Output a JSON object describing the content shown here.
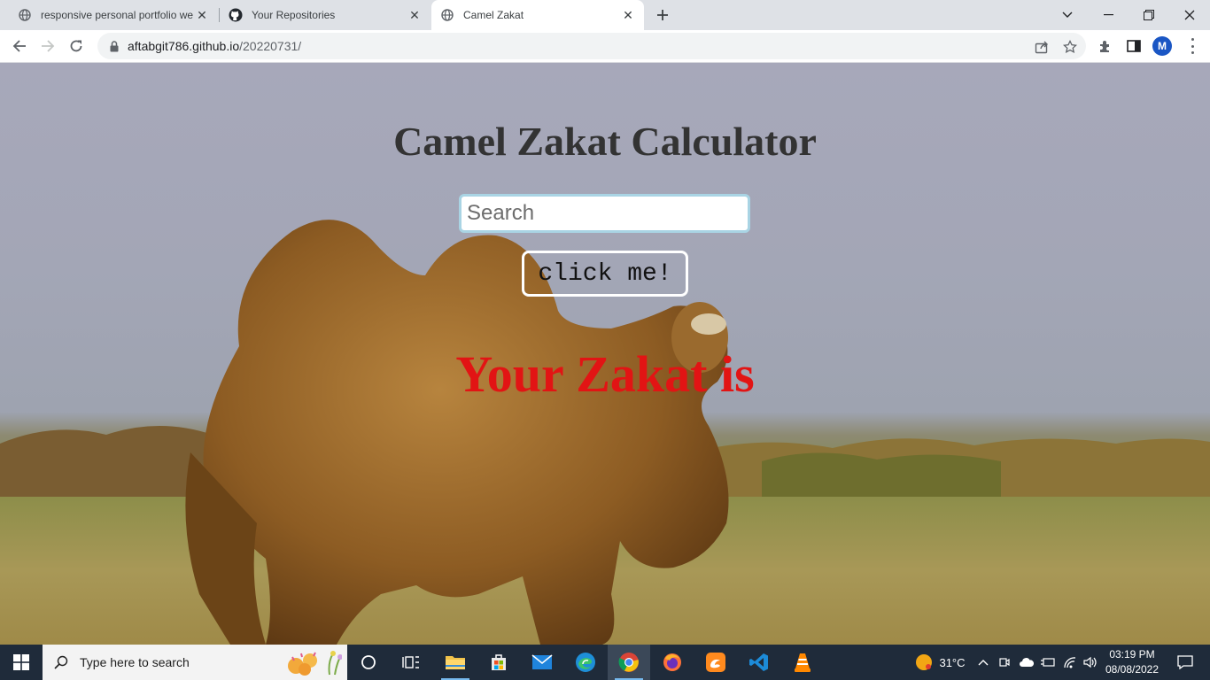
{
  "browser": {
    "tabs": [
      {
        "title": "responsive personal portfolio we",
        "icon": "globe-icon"
      },
      {
        "title": "Your Repositories",
        "icon": "github-icon"
      },
      {
        "title": "Camel Zakat",
        "icon": "globe-icon",
        "active": true
      }
    ],
    "address": {
      "host": "aftabgit786.github.io",
      "path": "/20220731/"
    },
    "profile_initial": "M"
  },
  "page": {
    "title": "Camel Zakat Calculator",
    "search_placeholder": "Search",
    "search_value": "",
    "button_label": "click me!",
    "result_text": "Your Zakat is",
    "colors": {
      "title": "#333333",
      "result": "#e21414",
      "input_border": "#a9d4e4",
      "button_border": "#ffffff"
    }
  },
  "taskbar": {
    "search_placeholder": "Type here to search",
    "weather": "31°C",
    "time": "03:19 PM",
    "date": "08/08/2022",
    "apps": [
      "cortana-icon",
      "task-view-icon",
      "file-explorer-icon",
      "store-icon",
      "mail-icon",
      "edge-icon",
      "chrome-icon",
      "firefox-icon",
      "uc-browser-icon",
      "vscode-icon",
      "vlc-icon"
    ]
  }
}
